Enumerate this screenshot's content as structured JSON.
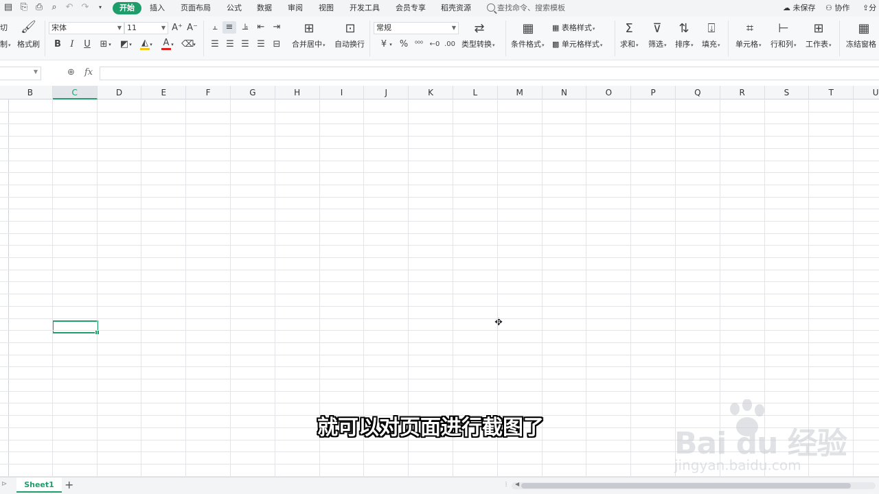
{
  "menubar": {
    "tabs": [
      "开始",
      "插入",
      "页面布局",
      "公式",
      "数据",
      "审阅",
      "视图",
      "开发工具",
      "会员专享",
      "稻壳资源"
    ],
    "active_tab": "开始",
    "search_placeholder": "查找命令、搜索模板",
    "unsaved": "未保存",
    "collaborate": "协作",
    "share": "分"
  },
  "ribbon": {
    "cut": "切",
    "copy": "制",
    "format_painter": "格式刷",
    "font_name": "宋体",
    "font_size": "11",
    "merge_center": "合并居中",
    "auto_wrap": "自动换行",
    "number_format": "常规",
    "type_convert": "类型转换",
    "conditional_format": "条件格式",
    "table_style": "表格样式",
    "cell_style": "单元格样式",
    "sum": "求和",
    "filter": "筛选",
    "sort": "排序",
    "fill": "填充",
    "cell": "单元格",
    "row_col": "行和列",
    "worksheet": "工作表",
    "freeze": "冻结窗格",
    "bold": "B",
    "italic": "I",
    "underline": "U",
    "currency": "¥",
    "percent": "%",
    "font_color_hex": "#e02020",
    "highlight_hex": "#f5c518"
  },
  "formula_bar": {
    "fx": "fx",
    "value": ""
  },
  "sheet": {
    "columns": [
      "B",
      "C",
      "D",
      "E",
      "F",
      "G",
      "H",
      "I",
      "J",
      "K",
      "L",
      "M",
      "N",
      "O",
      "P",
      "Q",
      "R",
      "S",
      "T",
      "U"
    ],
    "selected_column": "C",
    "tabs": [
      "Sheet1"
    ],
    "active_tab": "Sheet1",
    "accent_hex": "#1e9d6b"
  },
  "overlay": {
    "subtitle": "就可以对页面进行截图了",
    "watermark_brand": "Bai du 经验",
    "watermark_url": "jingyan.baidu.com"
  }
}
